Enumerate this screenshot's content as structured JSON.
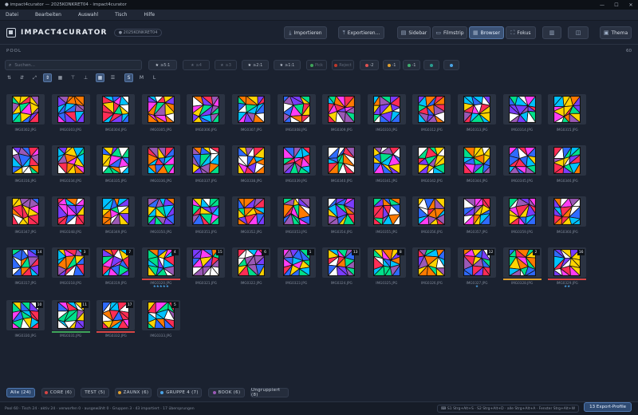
{
  "window": {
    "title": "● impact4curator — 2025KONKRET04 - impact4curator",
    "controls": [
      "—",
      "☐",
      "✕"
    ]
  },
  "menu": [
    "Datei",
    "Bearbeiten",
    "Auswahl",
    "Tisch",
    "Hilfe"
  ],
  "header": {
    "app_name": "IMPACT4CURATOR",
    "session": "● 2025KONKRET04",
    "buttons": {
      "import": "Importieren",
      "export": "Exportieren...",
      "sidebar": "Sidebar",
      "filmstrip": "Filmstrip",
      "browser": "Browser",
      "focus": "Fokus",
      "theme": "Thema"
    }
  },
  "pool": {
    "label": "POOL",
    "count": "60"
  },
  "search": {
    "placeholder": "Suchen..."
  },
  "filters": [
    {
      "label": "≥5:1",
      "icon": "★",
      "dim": false
    },
    {
      "label": "≥4",
      "icon": "★",
      "dim": true
    },
    {
      "label": "≥3",
      "icon": "★",
      "dim": true
    },
    {
      "label": "≥2:1",
      "icon": "★",
      "dim": false
    },
    {
      "label": "≥1:1",
      "icon": "★",
      "dim": false
    },
    {
      "label": "Pick",
      "dot": "#3fa45a",
      "dim": true
    },
    {
      "label": "Reject",
      "dot": "#c0392b",
      "dim": true
    },
    {
      "label": "-2",
      "dot": "#e05252",
      "dim": false
    },
    {
      "label": "-1",
      "dot": "#e0a030",
      "dim": false
    },
    {
      "label": "-1",
      "dot": "#3fb070",
      "dim": false
    },
    {
      "label": "",
      "dot": "#2a9d8f",
      "dim": false
    },
    {
      "label": "",
      "dot": "#4aa3e6",
      "dim": false
    }
  ],
  "toolbar": {
    "size_s": "S",
    "size_m": "M",
    "size_l": "L"
  },
  "thumbnails": [
    {
      "name": "IMG0302.JPG"
    },
    {
      "name": "IMG0303.JPG"
    },
    {
      "name": "IMG0304.JPG"
    },
    {
      "name": "IMG0305.JPG"
    },
    {
      "name": "IMG0306.JPG"
    },
    {
      "name": "IMG0307.JPG"
    },
    {
      "name": "IMG0308.JPG"
    },
    {
      "name": "IMG0309.JPG"
    },
    {
      "name": "IMG0310.JPG"
    },
    {
      "name": "IMG0312.JPG"
    },
    {
      "name": "IMG0313.JPG"
    },
    {
      "name": "IMG0314.JPG"
    },
    {
      "name": "IMG0315.JPG"
    },
    {
      "name": "IMG0316.JPG"
    },
    {
      "name": "IMG0334.JPG"
    },
    {
      "name": "IMG0335.JPG"
    },
    {
      "name": "IMG0336.JPG"
    },
    {
      "name": "IMG0337.JPG"
    },
    {
      "name": "IMG0338.JPG"
    },
    {
      "name": "IMG0339.JPG"
    },
    {
      "name": "IMG0340.JPG"
    },
    {
      "name": "IMG0341.JPG"
    },
    {
      "name": "IMG0342.JPG"
    },
    {
      "name": "IMG0344.JPG"
    },
    {
      "name": "IMG0345.JPG"
    },
    {
      "name": "IMG0346.JPG"
    },
    {
      "name": "IMG0347.JPG"
    },
    {
      "name": "IMG0348.JPG"
    },
    {
      "name": "IMG0349.JPG"
    },
    {
      "name": "IMG0350.JPG"
    },
    {
      "name": "IMG0351.JPG"
    },
    {
      "name": "IMG0352.JPG"
    },
    {
      "name": "IMG0353.JPG"
    },
    {
      "name": "IMG0354.JPG"
    },
    {
      "name": "IMG0355.JPG"
    },
    {
      "name": "IMG0356.JPG"
    },
    {
      "name": "IMG0357.JPG"
    },
    {
      "name": "IMG0359.JPG"
    },
    {
      "name": "IMG0360.JPG"
    },
    {
      "name": "IMG0317.JPG",
      "badge": "14"
    },
    {
      "name": "IMG0318.JPG",
      "badge": "3"
    },
    {
      "name": "IMG0319.JPG",
      "badge": "7"
    },
    {
      "name": "IMG0320.JPG",
      "badge": "4",
      "bar": "#d64545",
      "stars": "★★★★★"
    },
    {
      "name": "IMG0321.JPG",
      "badge": "15"
    },
    {
      "name": "IMG0322.JPG",
      "badge": "6"
    },
    {
      "name": "IMG0323.JPG",
      "badge": "1"
    },
    {
      "name": "IMG0324.JPG",
      "badge": "13"
    },
    {
      "name": "IMG0325.JPG",
      "badge": "8"
    },
    {
      "name": "IMG0326.JPG"
    },
    {
      "name": "IMG0327.JPG",
      "badge": "12",
      "stars": "★"
    },
    {
      "name": "IMG0328.JPG",
      "badge": "2",
      "bar": "#e0a030"
    },
    {
      "name": "IMG0329.JPG",
      "badge": "16",
      "bar": "#d64545",
      "stars": "★★"
    },
    {
      "name": "IMG0330.JPG",
      "badge": "10"
    },
    {
      "name": "IMG0331.JPG",
      "badge": "11",
      "bar": "#3fa45a"
    },
    {
      "name": "IMG0332.JPG",
      "badge": "17",
      "bar": "#d64545"
    },
    {
      "name": "IMG0333.JPG",
      "badge": "5"
    },
    {
      "name": "IMG0328_CROP.JPG"
    }
  ],
  "groups": [
    {
      "label": "Alle (24)",
      "active": true
    },
    {
      "label": "CORE (6)",
      "dot": "#d64545"
    },
    {
      "label": "TEST (5)"
    },
    {
      "label": "ZAUNX (6)",
      "dot": "#e0a030"
    },
    {
      "label": "GRUPPE 4 (7)",
      "dot": "#4aa3e6"
    },
    {
      "label": "BOOK (6)",
      "dot": "#9b59b6"
    },
    {
      "label": "Ungruppiert (8)"
    }
  ],
  "export_profiles": "13 Export-Profile",
  "status": {
    "text": "Pool 60 · Tisch 24 · aktiv 24 · verworfen 0 · ausgewählt 0 · Gruppen 3 · 43 importiert · 17 übersprungen",
    "hint": "⌨ S1 Strg+Alt+S · S2 Strg+Alt+D · alle Strg+Alt+A · Fenster Strg+Alt+W"
  },
  "palette": [
    "#ff2d55",
    "#ffd400",
    "#00c2ff",
    "#7a3cff",
    "#ff7a00",
    "#00e08a",
    "#ff3df5",
    "#2f6bff",
    "#ffffff",
    "#9b59b6"
  ]
}
